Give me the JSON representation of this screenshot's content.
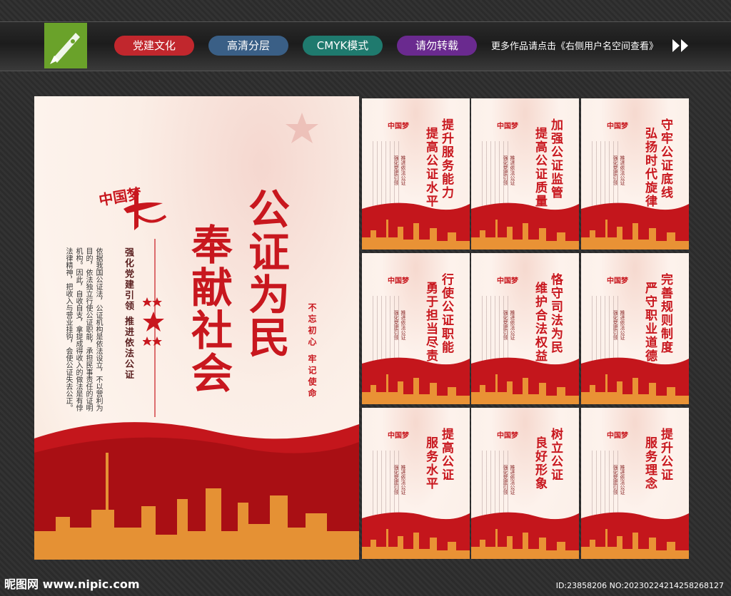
{
  "header": {
    "tags": [
      {
        "label": "党建文化",
        "color": "#c1272d"
      },
      {
        "label": "高清分层",
        "color": "#2f5f8f"
      },
      {
        "label": "CMYK模式",
        "color": "#1f7a6e"
      },
      {
        "label": "请勿转载",
        "color": "#6a2a8f"
      }
    ],
    "tagline": "更多作品请点击《右侧用户名空间查看》"
  },
  "main_poster": {
    "title_a": "公证为民",
    "title_b": "奉献社会",
    "subtitle": "强化党建引领 推进依法公证",
    "slogan": "不忘初心 牢记使命",
    "logo_text": "中国梦",
    "body": "依据我国公证法，公证机构是依法设立，不以营利为目的，依法独立行使公证职能，承担民事责任的证明机构。因此，自收自支，拿提成得收入的做法是有悖法律精神，把收入与营业挂钩，会使公证失去公正。"
  },
  "posters": [
    {
      "line1": "提升服务能力",
      "line2": "提高公证水平"
    },
    {
      "line1": "加强公证监管",
      "line2": "提高公证质量"
    },
    {
      "line1": "守牢公证底线",
      "line2": "弘扬时代旋律"
    },
    {
      "line1": "行使公证职能",
      "line2": "勇于担当尽责"
    },
    {
      "line1": "恪守司法为民",
      "line2": "维护合法权益"
    },
    {
      "line1": "完善规则制度",
      "line2": "严守职业道德"
    },
    {
      "line1": "提高公证",
      "line2": "服务水平"
    },
    {
      "line1": "树立公证",
      "line2": "良好形象"
    },
    {
      "line1": "提升公证",
      "line2": "服务理念"
    }
  ],
  "poster_mini": {
    "a": "强化党建引领",
    "b": "推进依法公证",
    "logo": "中国梦"
  },
  "footer": {
    "watermark": "昵图网 www.nipic.com",
    "id": "ID:23858206 NO:20230224214258268127"
  }
}
